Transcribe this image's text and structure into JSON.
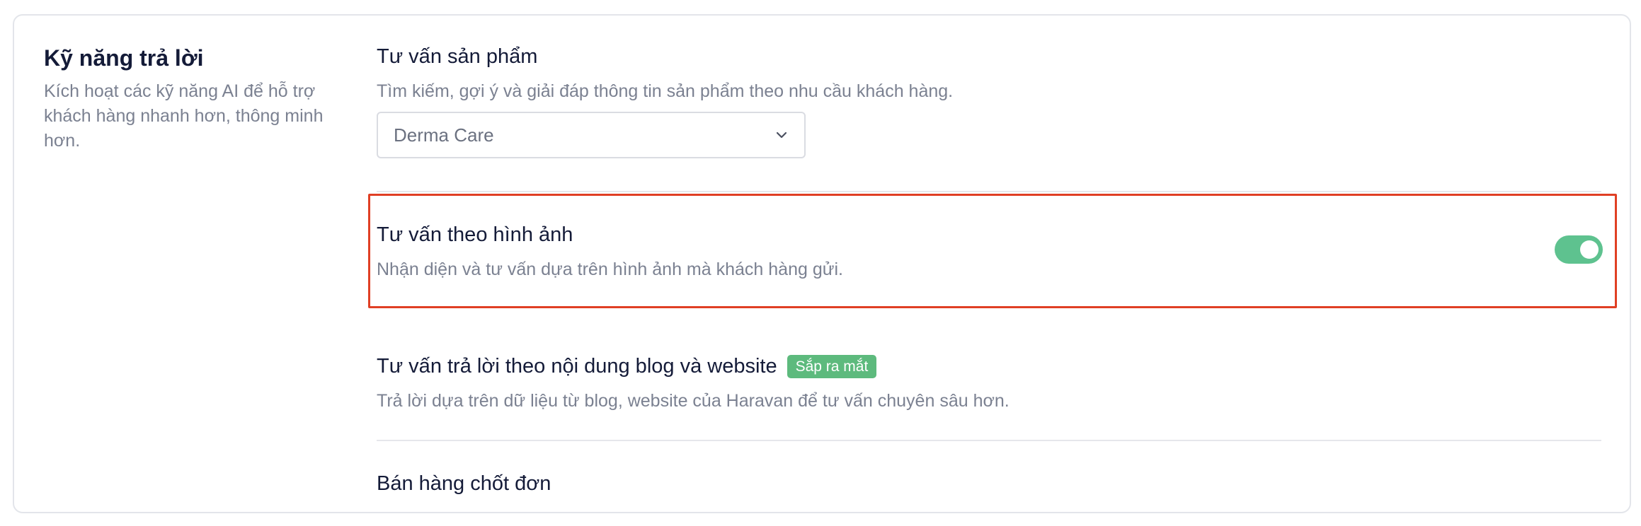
{
  "section": {
    "title": "Kỹ năng trả lời",
    "description": "Kích hoạt các kỹ năng AI để hỗ trợ khách hàng nhanh hơn, thông minh hơn."
  },
  "skills": {
    "product_consult": {
      "title": "Tư vấn sản phẩm",
      "description": "Tìm kiếm, gợi ý và giải đáp thông tin sản phẩm theo nhu cầu khách hàng.",
      "select_value": "Derma Care"
    },
    "image_consult": {
      "title": "Tư vấn theo hình ảnh",
      "description": "Nhận diện và tư vấn dựa trên hình ảnh mà khách hàng gửi.",
      "enabled": true,
      "highlight_color": "#e03f24",
      "toggle_color": "#5ec28f"
    },
    "blog_consult": {
      "title": "Tư vấn trả lời theo nội dung blog và website",
      "badge": "Sắp ra mắt",
      "badge_color": "#5dba7d",
      "description": "Trả lời dựa trên dữ liệu từ blog, website của Haravan để tư vấn chuyên sâu hơn."
    },
    "order_closing": {
      "title": "Bán hàng chốt đơn"
    }
  }
}
